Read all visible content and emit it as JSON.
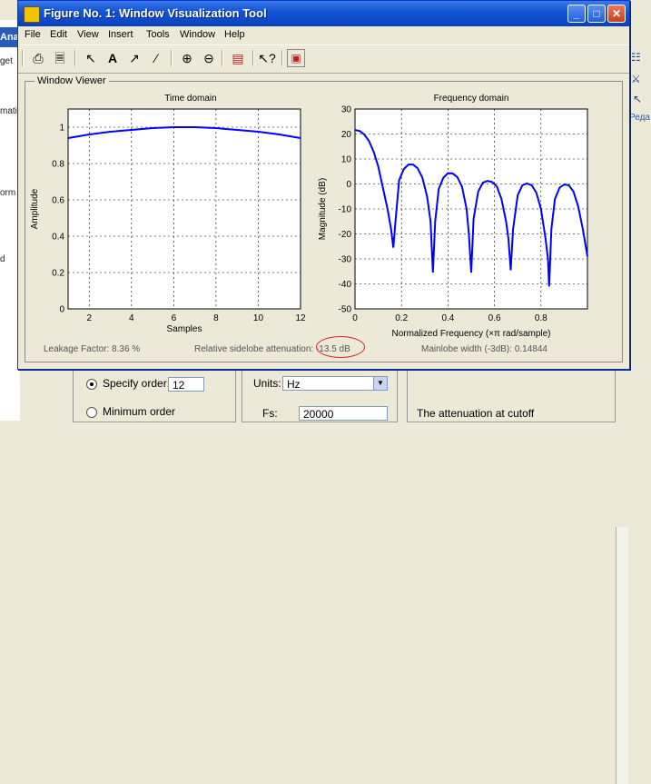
{
  "window": {
    "title": "Figure No. 1: Window Visualization Tool",
    "buttons": {
      "minimize": "_",
      "maximize": "□",
      "close": "✕"
    }
  },
  "menu": [
    "File",
    "Edit",
    "View",
    "Insert",
    "Tools",
    "Window",
    "Help"
  ],
  "panel_title": "Window Viewer",
  "time_plot": {
    "title": "Time domain",
    "xlabel": "Samples",
    "ylabel": "Amplitude",
    "x_ticks": [
      "2",
      "4",
      "6",
      "8",
      "10",
      "12"
    ],
    "y_ticks": [
      "0",
      "0.2",
      "0.4",
      "0.6",
      "0.8",
      "1"
    ]
  },
  "freq_plot": {
    "title": "Frequency domain",
    "xlabel": "Normalized Frequency  (×π rad/sample)",
    "ylabel": "Magnitude (dB)",
    "x_ticks": [
      "0",
      "0.2",
      "0.4",
      "0.6",
      "0.8"
    ],
    "y_ticks": [
      "-50",
      "-40",
      "-30",
      "-20",
      "-10",
      "0",
      "10",
      "20",
      "30"
    ]
  },
  "chart_data": [
    {
      "type": "line",
      "title": "Time domain",
      "xlabel": "Samples",
      "ylabel": "Amplitude",
      "xlim": [
        1,
        12
      ],
      "ylim": [
        0,
        1.1
      ],
      "grid": true,
      "color": "#0000ff",
      "x": [
        1,
        2,
        3,
        4,
        5,
        6,
        7,
        8,
        9,
        10,
        11,
        12
      ],
      "y": [
        0.94,
        0.96,
        0.975,
        0.985,
        0.995,
        1.0,
        1.0,
        0.995,
        0.985,
        0.975,
        0.96,
        0.94
      ]
    },
    {
      "type": "line",
      "title": "Frequency domain",
      "xlabel": "Normalized Frequency  (×π rad/sample)",
      "ylabel": "Magnitude (dB)",
      "xlim": [
        0,
        1
      ],
      "ylim": [
        -50,
        30
      ],
      "grid": true,
      "color": "#0000ff",
      "x": [
        0,
        0.02,
        0.04,
        0.06,
        0.08,
        0.1,
        0.12,
        0.14,
        0.155,
        0.165,
        0.175,
        0.19,
        0.21,
        0.23,
        0.25,
        0.27,
        0.29,
        0.31,
        0.325,
        0.335,
        0.345,
        0.36,
        0.38,
        0.4,
        0.42,
        0.44,
        0.46,
        0.48,
        0.49,
        0.5,
        0.51,
        0.53,
        0.55,
        0.57,
        0.59,
        0.61,
        0.63,
        0.65,
        0.66,
        0.67,
        0.68,
        0.7,
        0.72,
        0.74,
        0.76,
        0.78,
        0.8,
        0.82,
        0.83,
        0.835,
        0.845,
        0.86,
        0.88,
        0.9,
        0.92,
        0.94,
        0.96,
        0.98,
        1.0
      ],
      "y": [
        21.6,
        21.2,
        19.8,
        17.2,
        13.0,
        7.0,
        -1.5,
        -10.0,
        -18.0,
        -25.5,
        -14.0,
        1.5,
        6.0,
        7.8,
        7.8,
        6.2,
        2.5,
        -5.0,
        -15.0,
        -35.5,
        -15.0,
        -2.0,
        2.5,
        4.3,
        4.2,
        2.8,
        -1.0,
        -10.0,
        -20.0,
        -35.5,
        -14.0,
        -3.0,
        0.5,
        1.2,
        0.8,
        -1.0,
        -6.0,
        -15.0,
        -22.0,
        -34.5,
        -18.0,
        -4.5,
        -0.5,
        0.2,
        -0.5,
        -3.5,
        -10.0,
        -22.0,
        -30.0,
        -41.0,
        -18.0,
        -6.0,
        -1.5,
        -0.2,
        -0.5,
        -3.0,
        -9.0,
        -18.0,
        -29.0
      ]
    }
  ],
  "footer": {
    "leakage": "Leakage Factor: 8.36 %",
    "sidelobe": "Relative sidelobe attenuation: -13.5 dB",
    "mainlobe": "Mainlobe width (-3dB): 0.14844"
  },
  "background": {
    "left_fragments": [
      "Analy",
      "get",
      "matio",
      "orm R",
      "d"
    ],
    "right_fragments": [
      "Реда"
    ],
    "specify_order_label": "Specify order:",
    "order_value": "12",
    "minimum_order_label": "Minimum order",
    "units_label": "Units:",
    "units_value": "Hz",
    "fs_label": "Fs:",
    "fs_value": "20000",
    "attenuation_text": "The attenuation at cutoff"
  }
}
